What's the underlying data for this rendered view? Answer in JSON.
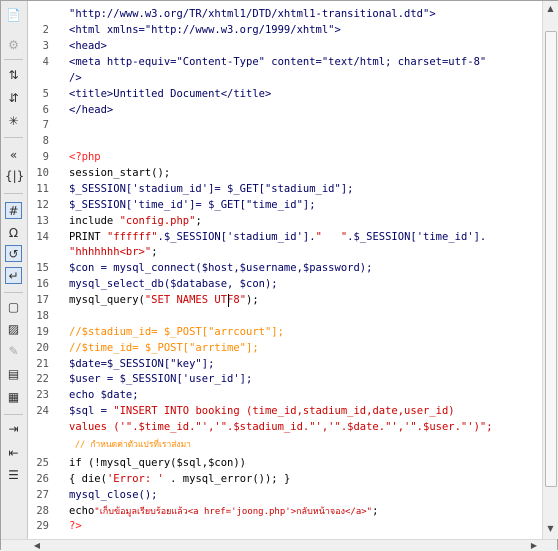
{
  "gutter": {
    "numbers": [
      "2",
      "3",
      "4",
      "5",
      "6",
      "7",
      "8",
      "9",
      "10",
      "11",
      "12",
      "13",
      "14",
      "15",
      "16",
      "17",
      "18",
      "19",
      "20",
      "21",
      "22",
      "23",
      "24",
      "25",
      "26",
      "27",
      "28",
      "29"
    ]
  },
  "code": {
    "l01": "\"http://www.w3.org/TR/xhtml1/DTD/xhtml1-transitional.dtd\">",
    "l02": "<html xmlns=\"http://www.w3.org/1999/xhtml\">",
    "l03": "<head>",
    "l04": "<meta http-equiv=\"Content-Type\" content=\"text/html; charset=utf-8\"",
    "l05": "/>",
    "l06": "<title>Untitled Document</title>",
    "l07": "</head>",
    "l08": "",
    "l09": "<?php",
    "l10": "session_start();",
    "l11": "$_SESSION['stadium_id']= $_GET[\"stadium_id\"];",
    "l12": "$_SESSION['time_id']= $_GET[\"time_id\"];",
    "l13a": "include ",
    "l13b": "\"config.php\"",
    "l13c": ";",
    "l14a": "PRINT ",
    "l14b": "\"ffffff\"",
    "l14c": ".$_SESSION['stadium_id'].",
    "l14d": "\"   \"",
    "l14e": ".$_SESSION['time_id'].",
    "l14f": "\"hhhhhhh<br>\"",
    "l14g": ";",
    "l15": "$con = mysql_connect($host,$username,$password);",
    "l16": "mysql_select_db($database, $con);",
    "l17a": "mysql_query(",
    "l17b": "\"SET NAMES ",
    "l17c": "UTF8\"",
    "l17d": ");",
    "l18": "",
    "l19": "//$stadium_id= $_POST[\"arrcourt\"];",
    "l20": "//$time_id= $_POST[\"arrtime\"];",
    "l21": "$date=$_SESSION[\"key\"];",
    "l22": "$user = $_SESSION['user_id'];",
    "l23": "echo $date;",
    "l24a": "$sql = ",
    "l24b": "\"INSERT INTO booking (time_id,stadium_id,date,user_id)",
    "l24c": "values ('\".$time_id.\"','\".$stadium_id.\"','\".$date.\"','\".$user.\"')\";",
    "l24d": "// กำหนดค่าตัวแปรที่เราส่งมา",
    "l25": "if (!mysql_query($sql,$con))",
    "l26a": "{ die(",
    "l26b": "'Error: '",
    "l26c": " . mysql_error()); }",
    "l27": "mysql_close();",
    "l28a": "echo",
    "l28b": "\"เก็บข้อมูลเรียบร้อยแล้ว<a href='joong.php'>กลับหน้าจอง</a>\"",
    "l28c": ";",
    "l29": "?>"
  },
  "toolbar": {
    "icons": [
      "open-documents-icon",
      "gear-icon",
      "collapse-full-tag-icon",
      "collapse-selection-icon",
      "expand-all-icon",
      "select-parent-tag-icon",
      "balance-braces-icon",
      "line-numbers-icon",
      "highlight-invalid-code-icon",
      "syntax-coloring-icon",
      "word-wrap-icon",
      "apply-comment-icon",
      "remove-comment-icon",
      "wrap-tag-icon",
      "recent-snippets-icon",
      "move-css-icon",
      "indent-code-icon",
      "outdent-code-icon",
      "format-source-code-icon"
    ]
  }
}
